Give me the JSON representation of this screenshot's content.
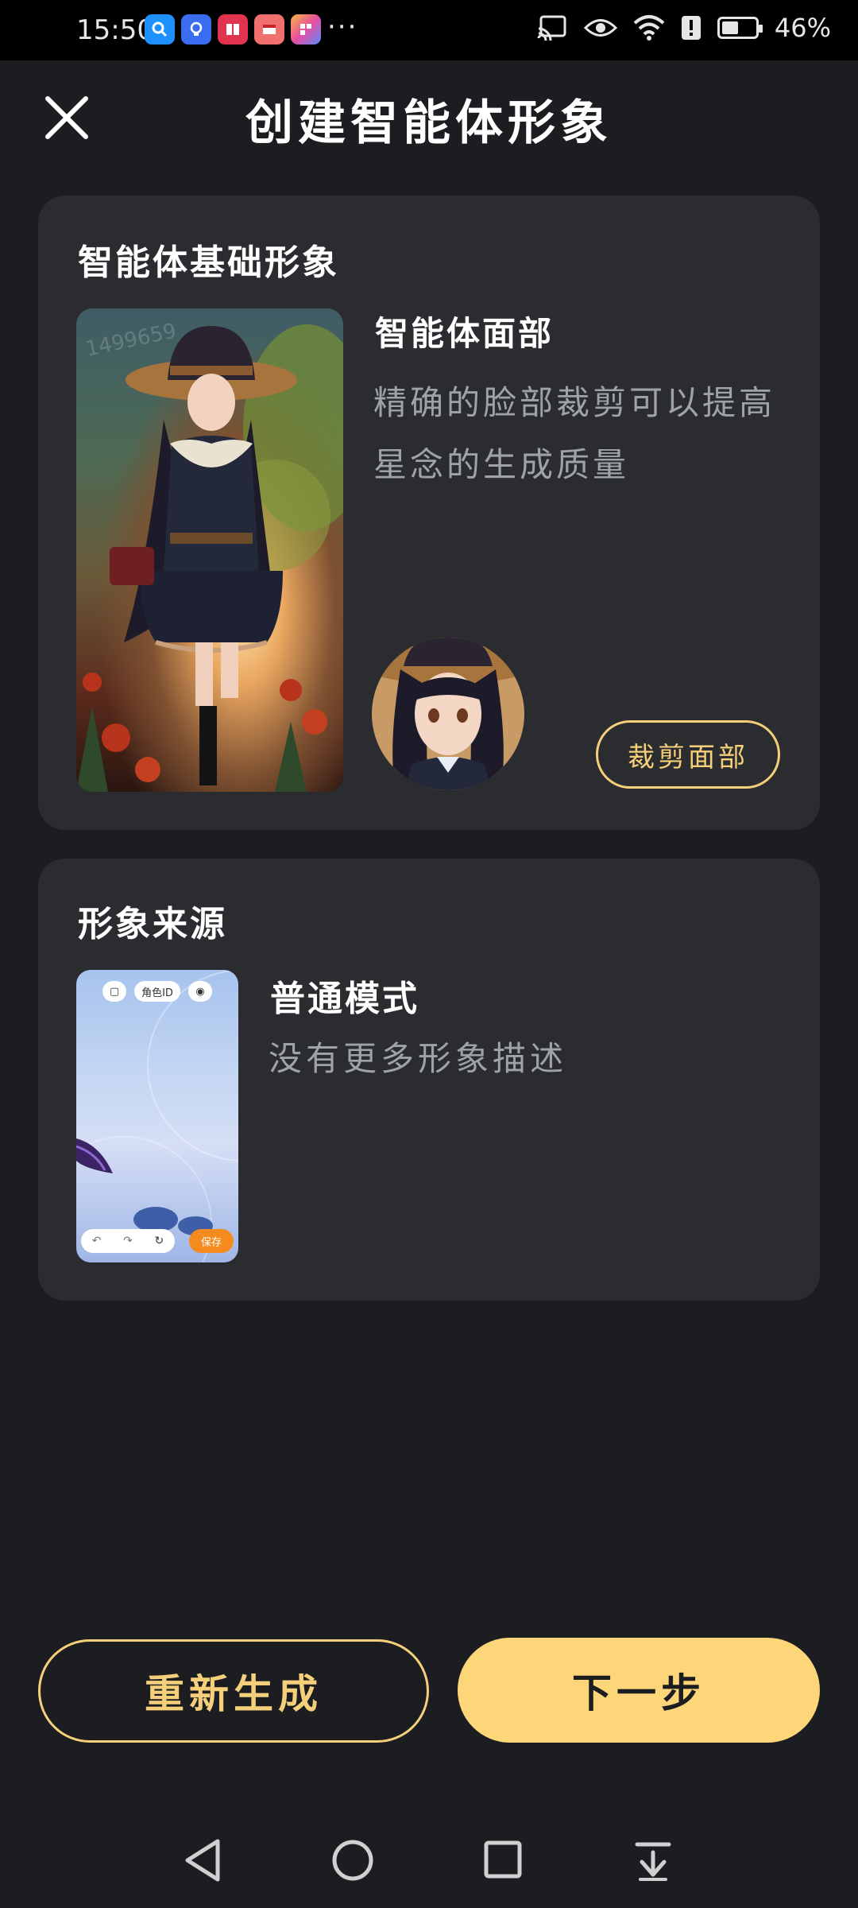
{
  "status_bar": {
    "time": "15:50",
    "battery_percent": "46%",
    "more_indicator": "···",
    "icons": [
      "search-app-icon",
      "bulb-app-icon",
      "book-app-icon",
      "reader-app-icon",
      "store-app-icon",
      "cast-icon",
      "eye-icon",
      "wifi-icon",
      "alert-icon",
      "battery-icon"
    ]
  },
  "header": {
    "title": "创建智能体形象",
    "close_icon": "close-icon"
  },
  "base_card": {
    "title": "智能体基础形象",
    "face_section_title": "智能体面部",
    "face_section_desc": "精确的脸部裁剪可以提高星念的生成质量",
    "crop_button_label": "裁剪面部"
  },
  "source_card": {
    "title": "形象来源",
    "mode_title": "普通模式",
    "mode_desc": "没有更多形象描述",
    "thumb_pill_label": "角色ID",
    "thumb_save_label": "保存"
  },
  "actions": {
    "regenerate_label": "重新生成",
    "next_label": "下一步"
  },
  "nav_bar": {
    "icons": [
      "back-icon",
      "home-icon",
      "recents-icon",
      "hide-nav-icon"
    ]
  },
  "colors": {
    "background": "#1b1d20",
    "card": "#2a2c30",
    "accent": "#fdd67a",
    "muted_text": "#9fa3a8"
  }
}
